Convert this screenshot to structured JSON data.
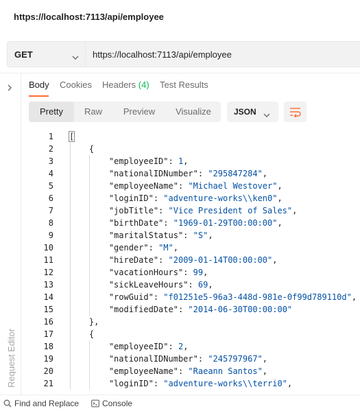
{
  "request": {
    "title": "https://localhost:7113/api/employee",
    "method": "GET",
    "url": "https://localhost:7113/api/employee"
  },
  "side_panel": {
    "label": "Request Editor"
  },
  "response_tabs": [
    {
      "label": "Body"
    },
    {
      "label": "Cookies"
    },
    {
      "label": "Headers",
      "count": "(4)"
    },
    {
      "label": "Test Results"
    }
  ],
  "format": {
    "modes": [
      "Pretty",
      "Raw",
      "Preview",
      "Visualize"
    ],
    "active_mode": "Pretty",
    "language": "JSON"
  },
  "colors": {
    "accent": "#ff6c37",
    "string": "#0451a5",
    "count": "#0cbb52"
  },
  "code_lines": [
    {
      "n": "1",
      "text": "["
    },
    {
      "n": "2",
      "text": "    {"
    },
    {
      "n": "3",
      "key": "employeeID",
      "val": "1",
      "type": "num"
    },
    {
      "n": "4",
      "key": "nationalIDNumber",
      "val": "\"295847284\"",
      "type": "str"
    },
    {
      "n": "5",
      "key": "employeeName",
      "val": "\"Michael Westover\"",
      "type": "str"
    },
    {
      "n": "6",
      "key": "loginID",
      "val": "\"adventure-works\\\\ken0\"",
      "type": "str"
    },
    {
      "n": "7",
      "key": "jobTitle",
      "val": "\"Vice President of Sales\"",
      "type": "str"
    },
    {
      "n": "8",
      "key": "birthDate",
      "val": "\"1969-01-29T00:00:00\"",
      "type": "str"
    },
    {
      "n": "9",
      "key": "maritalStatus",
      "val": "\"S\"",
      "type": "str"
    },
    {
      "n": "10",
      "key": "gender",
      "val": "\"M\"",
      "type": "str"
    },
    {
      "n": "11",
      "key": "hireDate",
      "val": "\"2009-01-14T00:00:00\"",
      "type": "str"
    },
    {
      "n": "12",
      "key": "vacationHours",
      "val": "99",
      "type": "num"
    },
    {
      "n": "13",
      "key": "sickLeaveHours",
      "val": "69",
      "type": "num"
    },
    {
      "n": "14",
      "key": "rowGuid",
      "val": "\"f01251e5-96a3-448d-981e-0f99d789110d\"",
      "type": "str"
    },
    {
      "n": "15",
      "key": "modifiedDate",
      "val": "\"2014-06-30T00:00:00\"",
      "type": "str",
      "last": true
    },
    {
      "n": "16",
      "text": "    },"
    },
    {
      "n": "17",
      "text": "    {"
    },
    {
      "n": "18",
      "key": "employeeID",
      "val": "2",
      "type": "num"
    },
    {
      "n": "19",
      "key": "nationalIDNumber",
      "val": "\"245797967\"",
      "type": "str"
    },
    {
      "n": "20",
      "key": "employeeName",
      "val": "\"Raeann Santos\"",
      "type": "str"
    },
    {
      "n": "21",
      "key": "loginID",
      "val": "\"adventure-works\\\\terri0\"",
      "type": "str"
    }
  ],
  "bottom_bar": {
    "find_replace": "Find and Replace",
    "console": "Console"
  }
}
